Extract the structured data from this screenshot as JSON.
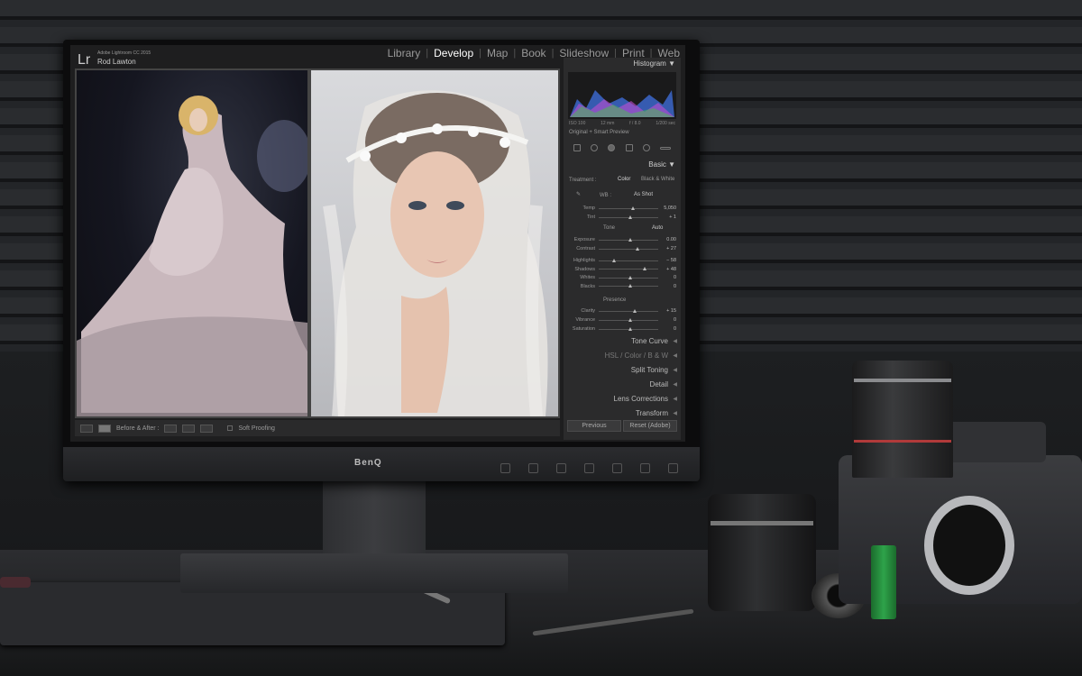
{
  "app": {
    "logo": "Lr",
    "name": "Adobe Lightroom CC 2015",
    "user": "Rod Lawton"
  },
  "modules": [
    "Library",
    "Develop",
    "Map",
    "Book",
    "Slideshow",
    "Print",
    "Web"
  ],
  "active_module": "Develop",
  "toolbar": {
    "before_after_label": "Before & After :",
    "soft_proofing": "Soft Proofing"
  },
  "panel": {
    "histogram_title": "Histogram",
    "histogram_info": [
      "ISO 100",
      "12 mm",
      "f / 8.0",
      "1/200 sec"
    ],
    "smart_preview": "Original + Smart Preview",
    "basic_title": "Basic",
    "treatment_label": "Treatment :",
    "treatment_color": "Color",
    "treatment_bw": "Black & White",
    "wb_label": "WB :",
    "wb_value": "As Shot",
    "tone_label": "Tone",
    "tone_auto": "Auto",
    "presence_label": "Presence",
    "sliders_wb": [
      {
        "label": "Temp",
        "value": "5,050",
        "pos": 0.55
      },
      {
        "label": "Tint",
        "value": "+ 1",
        "pos": 0.5
      }
    ],
    "sliders_tone": [
      {
        "label": "Exposure",
        "value": "0.00",
        "pos": 0.5
      },
      {
        "label": "Contrast",
        "value": "+ 27",
        "pos": 0.62
      }
    ],
    "sliders_tone2": [
      {
        "label": "Highlights",
        "value": "− 58",
        "pos": 0.22
      },
      {
        "label": "Shadows",
        "value": "+ 48",
        "pos": 0.74
      },
      {
        "label": "Whites",
        "value": "0",
        "pos": 0.5
      },
      {
        "label": "Blacks",
        "value": "0",
        "pos": 0.5
      }
    ],
    "sliders_presence": [
      {
        "label": "Clarity",
        "value": "+ 15",
        "pos": 0.58
      },
      {
        "label": "Vibrance",
        "value": "0",
        "pos": 0.5
      },
      {
        "label": "Saturation",
        "value": "0",
        "pos": 0.5
      }
    ],
    "sections": [
      "Tone Curve",
      "HSL / Color / B & W",
      "Split Toning",
      "Detail",
      "Lens Corrections",
      "Transform"
    ],
    "previous_button": "Previous",
    "reset_button": "Reset (Adobe)"
  },
  "monitor_brand": "BenQ"
}
